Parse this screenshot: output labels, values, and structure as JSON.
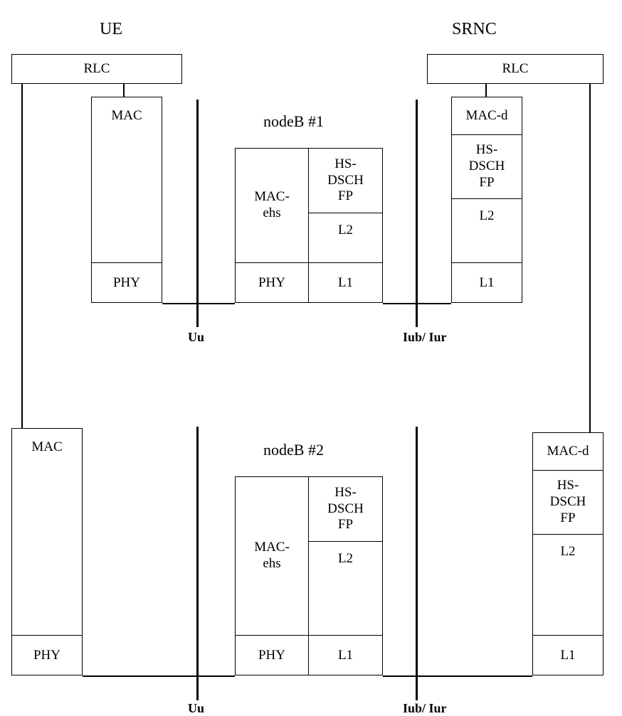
{
  "headers": {
    "ue": "UE",
    "srnc": "SRNC"
  },
  "rlc": {
    "left": "RLC",
    "right": "RLC"
  },
  "ue_stack1": {
    "mac": "MAC",
    "phy": "PHY"
  },
  "ue_stack2": {
    "mac": "MAC",
    "phy": "PHY"
  },
  "srnc_stack1": {
    "macd": "MAC-d",
    "hs": "HS-\nDSCH\nFP",
    "l2": "L2",
    "l1": "L1"
  },
  "srnc_stack2": {
    "macd": "MAC-d",
    "hs": "HS-\nDSCH\nFP",
    "l2": "L2",
    "l1": "L1"
  },
  "nodeb1": {
    "title": "nodeB #1",
    "mac_ehs": "MAC-\nehs",
    "phy": "PHY",
    "hs": "HS-\nDSCH\nFP",
    "l2": "L2",
    "l1": "L1"
  },
  "nodeb2": {
    "title": "nodeB #2",
    "mac_ehs": "MAC-\nehs",
    "phy": "PHY",
    "hs": "HS-\nDSCH\nFP",
    "l2": "L2",
    "l1": "L1"
  },
  "iface": {
    "uu": "Uu",
    "iub": "Iub/ Iur"
  }
}
